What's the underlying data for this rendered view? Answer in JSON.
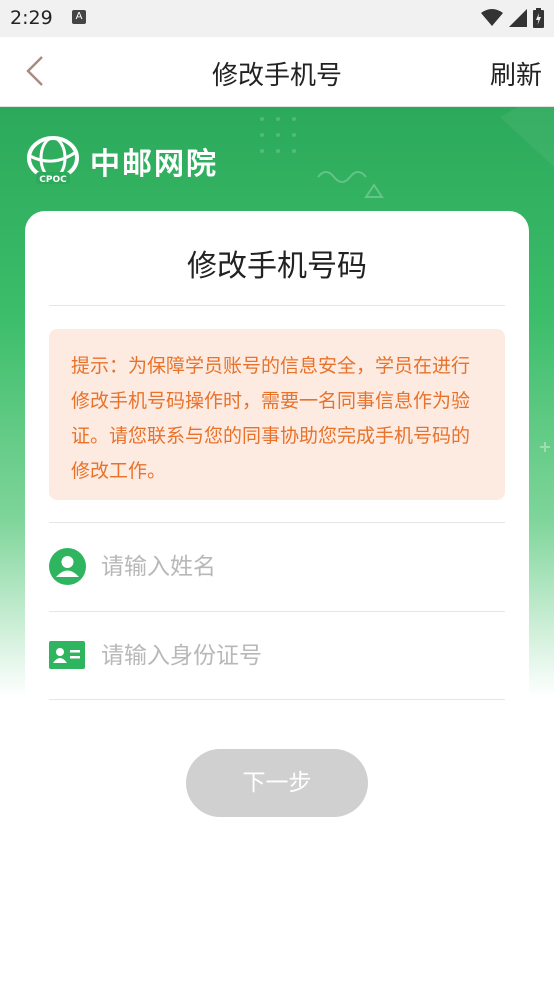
{
  "status_bar": {
    "time": "2:29",
    "notif_letter": "A"
  },
  "nav": {
    "title": "修改手机号",
    "refresh_label": "刷新"
  },
  "brand": {
    "name": "中邮网院",
    "badge": "CPOC"
  },
  "card": {
    "title": "修改手机号码",
    "notice": "提示：为保障学员账号的信息安全，学员在进行修改手机号码操作时，需要一名同事信息作为验证。请您联系与您的同事协助您完成手机号码的修改工作。",
    "name_field": {
      "placeholder": "请输入姓名",
      "value": ""
    },
    "id_field": {
      "placeholder": "请输入身份证号",
      "value": ""
    },
    "next_label": "下一步"
  },
  "colors": {
    "green": "#2ca95b",
    "notice_bg": "#fdebe2",
    "notice_text": "#e8722a",
    "disabled_btn": "#d0d0d0"
  }
}
